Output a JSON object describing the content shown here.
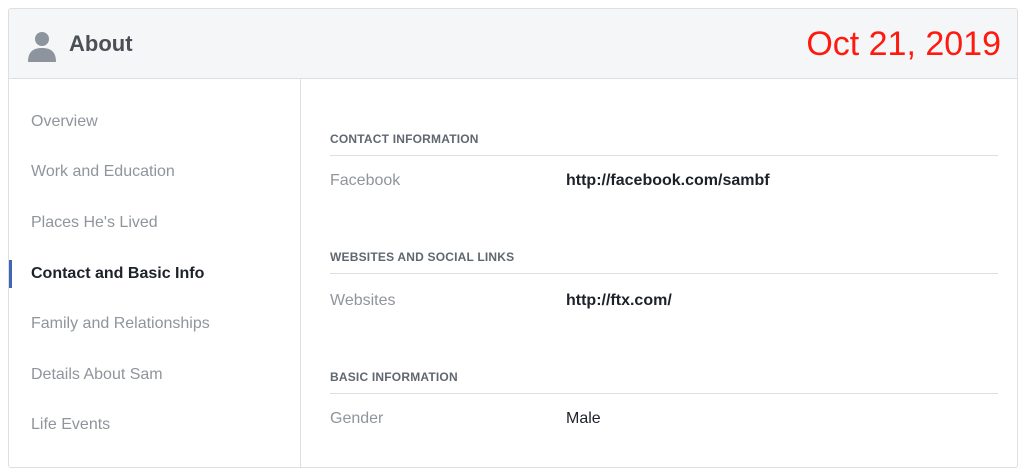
{
  "header": {
    "title": "About",
    "date": "Oct 21, 2019",
    "icon": "person-icon"
  },
  "sidebar": {
    "items": [
      {
        "label": "Overview"
      },
      {
        "label": "Work and Education"
      },
      {
        "label": "Places He's Lived"
      },
      {
        "label": "Contact and Basic Info"
      },
      {
        "label": "Family and Relationships"
      },
      {
        "label": "Details About Sam"
      },
      {
        "label": "Life Events"
      }
    ],
    "active_index": 3
  },
  "sections": [
    {
      "title": "CONTACT INFORMATION",
      "rows": [
        {
          "label": "Facebook",
          "value": "http://facebook.com/sambf"
        }
      ]
    },
    {
      "title": "WEBSITES AND SOCIAL LINKS",
      "rows": [
        {
          "label": "Websites",
          "value": "http://ftx.com/"
        }
      ]
    },
    {
      "title": "BASIC INFORMATION",
      "rows": [
        {
          "label": "Gender",
          "value": "Male"
        }
      ]
    }
  ],
  "colors": {
    "accent": "#4267b2",
    "date": "#ff1a0f",
    "header_bg": "#f5f6f7"
  }
}
